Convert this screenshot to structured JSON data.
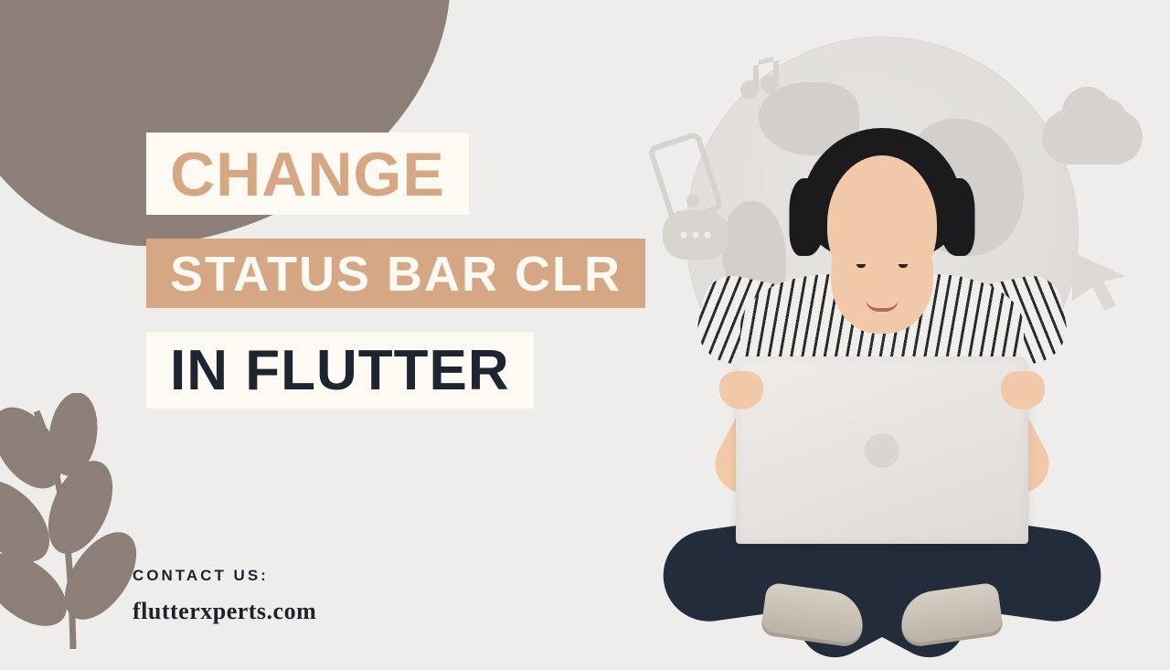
{
  "headline": {
    "line1": "CHANGE",
    "line2": "STATUS BAR CLR",
    "line3": "IN FLUTTER"
  },
  "contact": {
    "label": "CONTACT US:",
    "site": "flutterxperts.com"
  },
  "icons": {
    "phone": "phone-icon",
    "note": "music-note-icon",
    "cloud": "cloud-icon",
    "cursor": "cursor-arrow-icon",
    "bubble": "chat-bubble-icon",
    "globe": "globe-icon",
    "leaf": "leaf-icon"
  },
  "colors": {
    "bg": "#efedec",
    "blob": "#8b7f78",
    "tan": "#d6a784",
    "dark": "#1d2530",
    "offwhite": "#fdf9f3"
  }
}
